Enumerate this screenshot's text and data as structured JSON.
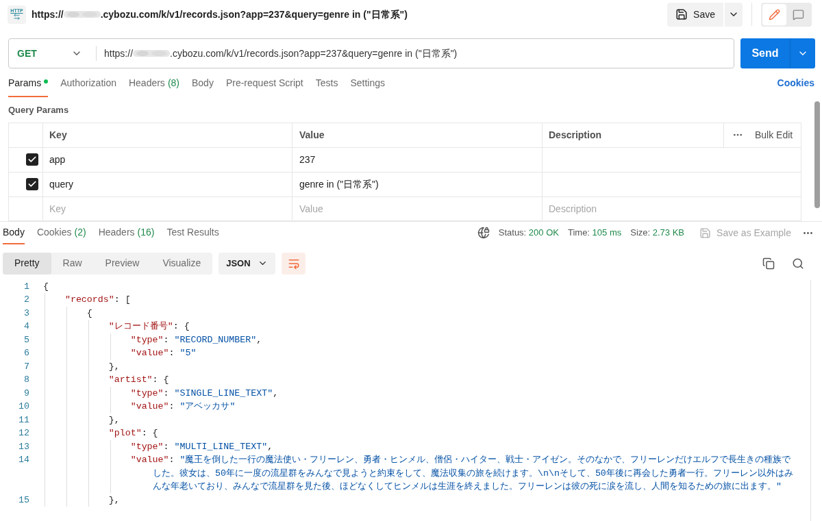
{
  "request_title": {
    "icon_label": "HTTP",
    "prefix": "https://",
    "suffix": ".cybozu.com/k/v1/records.json?app=237&query=genre in (\"日常系\")"
  },
  "save_button": "Save",
  "modes": [
    {
      "kind": "edit",
      "selected": true
    },
    {
      "kind": "comment",
      "selected": false
    }
  ],
  "method": "GET",
  "url": {
    "prefix": "https://",
    "suffix": ".cybozu.com/k/v1/records.json?app=237&query=genre in (\"日常系\")"
  },
  "send_button": "Send",
  "request_tabs": [
    {
      "label": "Params",
      "selected": true,
      "dot": true
    },
    {
      "label": "Authorization",
      "selected": false,
      "dot": false
    },
    {
      "label": "Headers",
      "count": "(8)",
      "selected": false,
      "dot": false
    },
    {
      "label": "Body",
      "selected": false,
      "dot": false
    },
    {
      "label": "Pre-request Script",
      "selected": false,
      "dot": false
    },
    {
      "label": "Tests",
      "selected": false,
      "dot": false
    },
    {
      "label": "Settings",
      "selected": false,
      "dot": false
    }
  ],
  "cookies_link": "Cookies",
  "query_params": {
    "title": "Query Params",
    "columns": [
      "Key",
      "Value",
      "Description"
    ],
    "bulk_edit": "Bulk Edit",
    "rows": [
      {
        "checked": true,
        "key": "app",
        "value": "237"
      },
      {
        "checked": true,
        "key": "query",
        "value": "genre in (\"日常系\")"
      }
    ],
    "new_row": {
      "key": {
        "placeholder": "Key"
      },
      "value": {
        "placeholder": "Value"
      },
      "description": {
        "placeholder": "Description"
      }
    }
  },
  "response_tabs": [
    {
      "label": "Body",
      "selected": true
    },
    {
      "label": "Cookies",
      "count": "(2)",
      "selected": false
    },
    {
      "label": "Headers",
      "count": "(16)",
      "selected": false
    },
    {
      "label": "Test Results",
      "selected": false
    }
  ],
  "status": [
    {
      "label": "Status:",
      "value": "200 OK"
    },
    {
      "label": "Time:",
      "value": "105 ms"
    },
    {
      "label": "Size:",
      "value": "2.73 KB"
    }
  ],
  "save_example": "Save as Example",
  "view_modes": [
    {
      "label": "Pretty",
      "selected": true
    },
    {
      "label": "Raw",
      "selected": false
    },
    {
      "label": "Preview",
      "selected": false
    },
    {
      "label": "Visualize",
      "selected": false
    }
  ],
  "format": "JSON",
  "wrap_lines": true,
  "code_lines": [
    {
      "number": "1",
      "tokens": [
        {
          "kind": "punct",
          "text": "{"
        }
      ]
    },
    {
      "number": "2",
      "tokens": [
        {
          "kind": "key",
          "text": "    \"records\""
        },
        {
          "kind": "punct",
          "text": ": ["
        }
      ]
    },
    {
      "number": "3",
      "tokens": [
        {
          "kind": "punct",
          "text": "        {"
        }
      ]
    },
    {
      "number": "4",
      "tokens": [
        {
          "kind": "key",
          "text": "            \"レコード番号\""
        },
        {
          "kind": "punct",
          "text": ": {"
        }
      ]
    },
    {
      "number": "5",
      "tokens": [
        {
          "kind": "key",
          "text": "                \"type\""
        },
        {
          "kind": "punct",
          "text": ": "
        },
        {
          "kind": "string",
          "text": "\"RECORD_NUMBER\""
        },
        {
          "kind": "punct",
          "text": ","
        }
      ]
    },
    {
      "number": "6",
      "tokens": [
        {
          "kind": "key",
          "text": "                \"value\""
        },
        {
          "kind": "punct",
          "text": ": "
        },
        {
          "kind": "string",
          "text": "\"5\""
        }
      ]
    },
    {
      "number": "7",
      "tokens": [
        {
          "kind": "punct",
          "text": "            },"
        }
      ]
    },
    {
      "number": "8",
      "tokens": [
        {
          "kind": "key",
          "text": "            \"artist\""
        },
        {
          "kind": "punct",
          "text": ": {"
        }
      ]
    },
    {
      "number": "9",
      "tokens": [
        {
          "kind": "key",
          "text": "                \"type\""
        },
        {
          "kind": "punct",
          "text": ": "
        },
        {
          "kind": "string",
          "text": "\"SINGLE_LINE_TEXT\""
        },
        {
          "kind": "punct",
          "text": ","
        }
      ]
    },
    {
      "number": "10",
      "tokens": [
        {
          "kind": "key",
          "text": "                \"value\""
        },
        {
          "kind": "punct",
          "text": ": "
        },
        {
          "kind": "string",
          "text": "\"アベッカサ\""
        }
      ]
    },
    {
      "number": "11",
      "tokens": [
        {
          "kind": "punct",
          "text": "            },"
        }
      ]
    },
    {
      "number": "12",
      "tokens": [
        {
          "kind": "key",
          "text": "            \"plot\""
        },
        {
          "kind": "punct",
          "text": ": {"
        }
      ]
    },
    {
      "number": "13",
      "tokens": [
        {
          "kind": "key",
          "text": "                \"type\""
        },
        {
          "kind": "punct",
          "text": ": "
        },
        {
          "kind": "string",
          "text": "\"MULTI_LINE_TEXT\""
        },
        {
          "kind": "punct",
          "text": ","
        }
      ]
    },
    {
      "number": "14",
      "tokens": [
        {
          "kind": "key",
          "text": "                \"value\""
        },
        {
          "kind": "punct",
          "text": ": "
        },
        {
          "kind": "string",
          "text": "\"魔王を倒した一行の魔法使い・フリーレン、勇者・ヒンメル、僧侶・ハイター、戦士・アイゼン。そのなかで、フリーレンだけエルフで長生きの種族でした。彼女は、50年に一度の流星群をみんなで見ようと約束をして、魔法収集の旅を続けます。\\n\\nそして、50年後に再会した勇者一行。フリーレン以外はみんな年老いており、みんなで流星群を見た後、ほどなくしてヒンメルは生涯を終えました。フリーレンは彼の死に涙を流し、人間を知るための旅に出ます。\""
        }
      ]
    },
    {
      "number": "15",
      "tokens": [
        {
          "kind": "punct",
          "text": "            },"
        }
      ]
    }
  ]
}
